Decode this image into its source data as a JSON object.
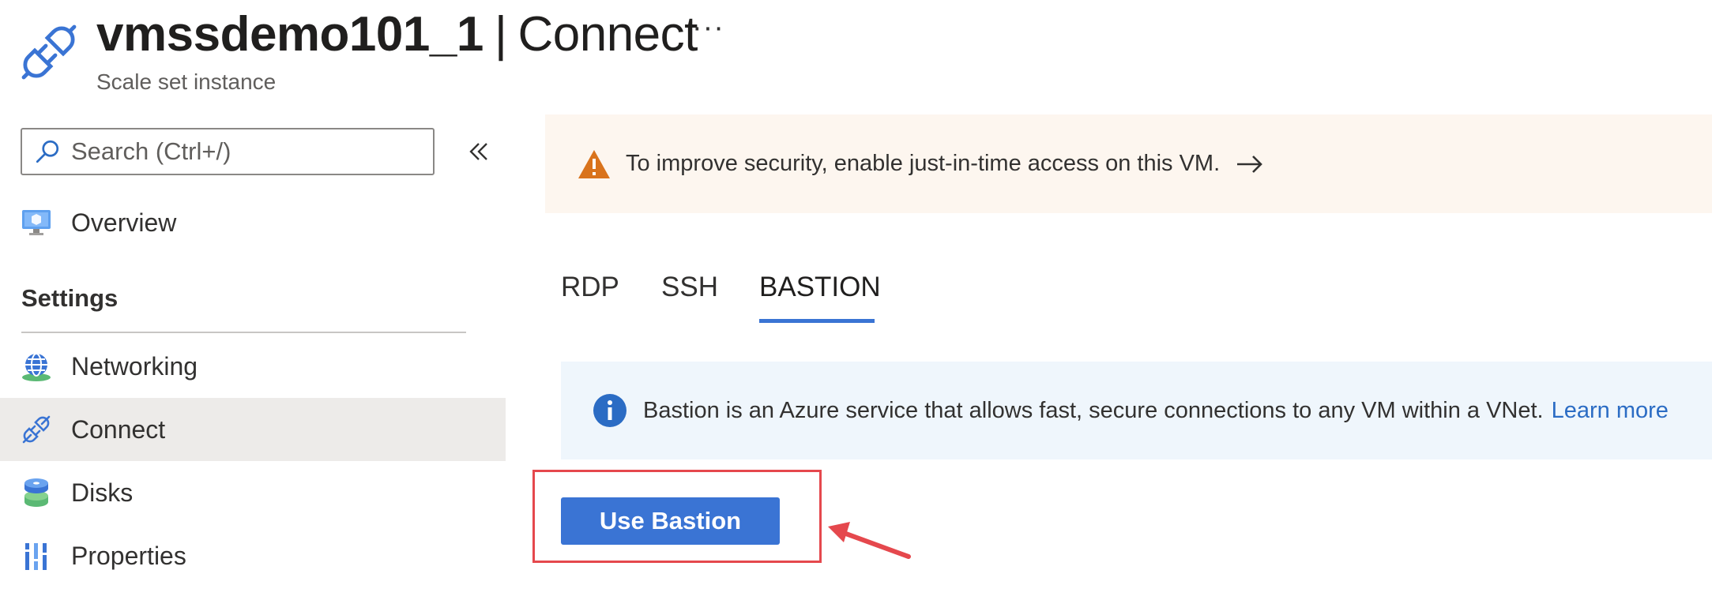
{
  "header": {
    "resource_name": "vmssdemo101_1",
    "separator": "|",
    "page_name": "Connect",
    "subtitle": "Scale set instance",
    "more_label": "···"
  },
  "sidebar": {
    "search_placeholder": "Search (Ctrl+/)",
    "search_value": "",
    "collapse_glyph": "«",
    "items": [
      {
        "label": "Overview",
        "icon": "monitor-icon"
      },
      {
        "label": "Networking",
        "icon": "globe-network-icon"
      },
      {
        "label": "Connect",
        "icon": "plug-icon",
        "active": true
      },
      {
        "label": "Disks",
        "icon": "disks-icon"
      },
      {
        "label": "Properties",
        "icon": "properties-icon"
      }
    ],
    "section_settings": "Settings"
  },
  "main": {
    "warning": {
      "text": "To improve security, enable just-in-time access on this VM.",
      "icon": "warning-icon"
    },
    "tabs": [
      {
        "label": "RDP"
      },
      {
        "label": "SSH"
      },
      {
        "label": "BASTION",
        "selected": true
      }
    ],
    "info": {
      "text": "Bastion is an Azure service that allows fast, secure connections to any VM within a VNet.",
      "link": "Learn more",
      "icon": "info-icon"
    },
    "use_bastion_label": "Use Bastion"
  },
  "colors": {
    "accent": "#3a74d4",
    "warning_bg": "#fdf6ef",
    "info_bg": "#eff6fc",
    "highlight": "#e5484d",
    "active_nav_bg": "#edebe9"
  }
}
